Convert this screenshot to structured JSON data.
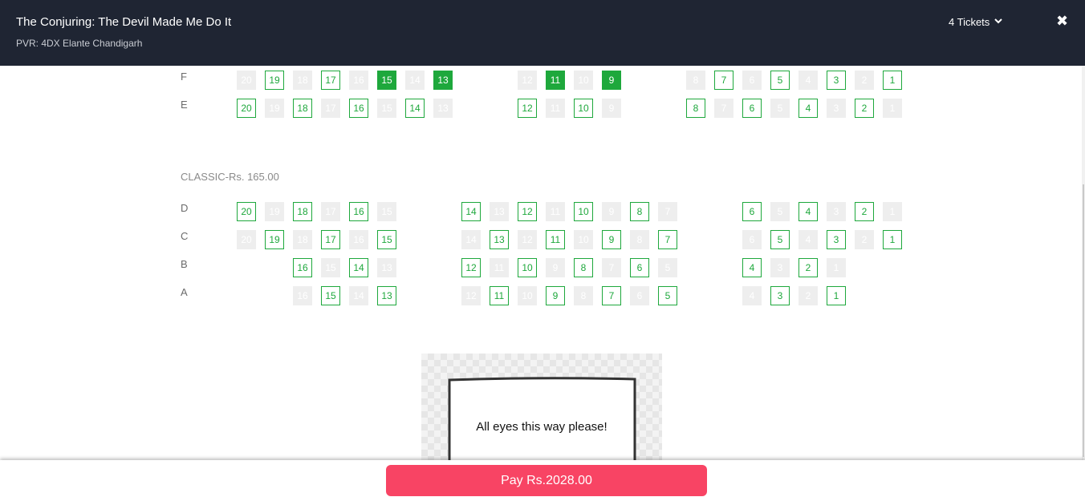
{
  "header": {
    "movie_title": "The Conjuring: The Devil Made Me Do It",
    "venue": "PVR: 4DX Elante Chandigarh",
    "tickets_label": "4 Tickets",
    "tickets_icon": "chevron-down-icon",
    "close_icon": "close-icon",
    "close_glyph": "✖"
  },
  "colors": {
    "header_bg": "#1f2533",
    "available": "#1ea83c",
    "selected": "#1ea83c",
    "sold": "#eeeeee",
    "pay_button": "#f84464"
  },
  "seat_legend_states": [
    "available",
    "sold",
    "selected"
  ],
  "sections": [
    {
      "label": "",
      "rows": [
        {
          "name": "F",
          "blocks": [
            [
              [
                20,
                "sold"
              ],
              [
                19,
                "available"
              ],
              [
                18,
                "sold"
              ],
              [
                17,
                "available"
              ],
              [
                16,
                "sold"
              ],
              [
                15,
                "selected"
              ],
              [
                14,
                "sold"
              ],
              [
                13,
                "selected"
              ]
            ],
            [
              [
                12,
                "sold"
              ],
              [
                11,
                "selected"
              ],
              [
                10,
                "sold"
              ],
              [
                9,
                "selected"
              ]
            ],
            [
              [
                8,
                "sold"
              ],
              [
                7,
                "available"
              ],
              [
                6,
                "sold"
              ],
              [
                5,
                "available"
              ],
              [
                4,
                "sold"
              ],
              [
                3,
                "available"
              ],
              [
                2,
                "sold"
              ],
              [
                1,
                "available"
              ]
            ]
          ]
        },
        {
          "name": "E",
          "blocks": [
            [
              [
                20,
                "available"
              ],
              [
                19,
                "sold"
              ],
              [
                18,
                "available"
              ],
              [
                17,
                "sold"
              ],
              [
                16,
                "available"
              ],
              [
                15,
                "sold"
              ],
              [
                14,
                "available"
              ],
              [
                13,
                "sold"
              ]
            ],
            [
              [
                12,
                "available"
              ],
              [
                11,
                "sold"
              ],
              [
                10,
                "available"
              ],
              [
                9,
                "sold"
              ]
            ],
            [
              [
                8,
                "available"
              ],
              [
                7,
                "sold"
              ],
              [
                6,
                "available"
              ],
              [
                5,
                "sold"
              ],
              [
                4,
                "available"
              ],
              [
                3,
                "sold"
              ],
              [
                2,
                "available"
              ],
              [
                1,
                "sold"
              ]
            ]
          ]
        }
      ]
    },
    {
      "label": "CLASSIC-Rs. 165.00",
      "rows": [
        {
          "name": "D",
          "blocks": [
            [
              [
                20,
                "available"
              ],
              [
                19,
                "sold"
              ],
              [
                18,
                "available"
              ],
              [
                17,
                "sold"
              ],
              [
                16,
                "available"
              ],
              [
                15,
                "sold"
              ]
            ],
            [
              [
                14,
                "available"
              ],
              [
                13,
                "sold"
              ],
              [
                12,
                "available"
              ],
              [
                11,
                "sold"
              ],
              [
                10,
                "available"
              ],
              [
                9,
                "sold"
              ],
              [
                8,
                "available"
              ],
              [
                7,
                "sold"
              ]
            ],
            [
              [
                6,
                "available"
              ],
              [
                5,
                "sold"
              ],
              [
                4,
                "available"
              ],
              [
                3,
                "sold"
              ],
              [
                2,
                "available"
              ],
              [
                1,
                "sold"
              ]
            ]
          ]
        },
        {
          "name": "C",
          "blocks": [
            [
              [
                20,
                "sold"
              ],
              [
                19,
                "available"
              ],
              [
                18,
                "sold"
              ],
              [
                17,
                "available"
              ],
              [
                16,
                "sold"
              ],
              [
                15,
                "available"
              ]
            ],
            [
              [
                14,
                "sold"
              ],
              [
                13,
                "available"
              ],
              [
                12,
                "sold"
              ],
              [
                11,
                "available"
              ],
              [
                10,
                "sold"
              ],
              [
                9,
                "available"
              ],
              [
                8,
                "sold"
              ],
              [
                7,
                "available"
              ]
            ],
            [
              [
                6,
                "sold"
              ],
              [
                5,
                "available"
              ],
              [
                4,
                "sold"
              ],
              [
                3,
                "available"
              ],
              [
                2,
                "sold"
              ],
              [
                1,
                "available"
              ]
            ]
          ]
        },
        {
          "name": "B",
          "blocks": [
            [
              [
                16,
                "available"
              ],
              [
                15,
                "sold"
              ],
              [
                14,
                "available"
              ],
              [
                13,
                "sold"
              ]
            ],
            [
              [
                12,
                "available"
              ],
              [
                11,
                "sold"
              ],
              [
                10,
                "available"
              ],
              [
                9,
                "sold"
              ],
              [
                8,
                "available"
              ],
              [
                7,
                "sold"
              ],
              [
                6,
                "available"
              ],
              [
                5,
                "sold"
              ]
            ],
            [
              [
                4,
                "available"
              ],
              [
                3,
                "sold"
              ],
              [
                2,
                "available"
              ],
              [
                1,
                "sold"
              ]
            ]
          ]
        },
        {
          "name": "A",
          "blocks": [
            [
              [
                16,
                "sold"
              ],
              [
                15,
                "available"
              ],
              [
                14,
                "sold"
              ],
              [
                13,
                "available"
              ]
            ],
            [
              [
                12,
                "sold"
              ],
              [
                11,
                "available"
              ],
              [
                10,
                "sold"
              ],
              [
                9,
                "available"
              ],
              [
                8,
                "sold"
              ],
              [
                7,
                "available"
              ],
              [
                6,
                "sold"
              ],
              [
                5,
                "available"
              ]
            ],
            [
              [
                4,
                "sold"
              ],
              [
                3,
                "available"
              ],
              [
                2,
                "sold"
              ],
              [
                1,
                "available"
              ]
            ]
          ]
        }
      ]
    }
  ],
  "screen": {
    "text": "All eyes this way please!"
  },
  "footer": {
    "pay_label": "Pay Rs.2028.00"
  }
}
